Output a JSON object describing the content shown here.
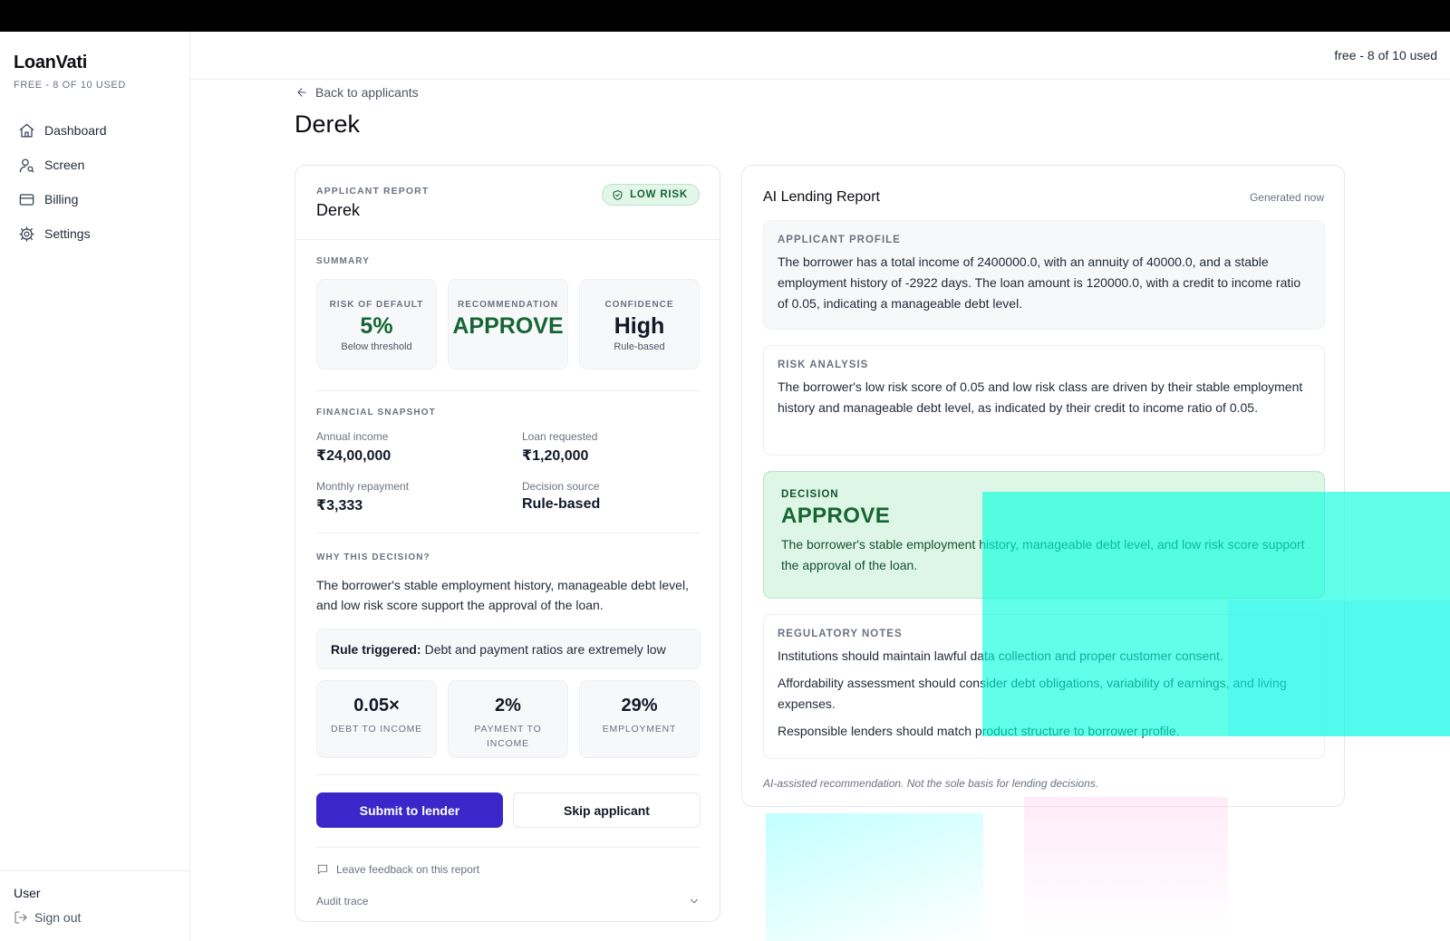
{
  "app": {
    "brand": "LoanVati",
    "plan": "FREE - 8 OF 10 USED",
    "usage": "free - 8 of 10 used"
  },
  "sidebar": {
    "items": [
      {
        "label": "Dashboard",
        "icon": "home-icon"
      },
      {
        "label": "Screen",
        "icon": "user-search-icon"
      },
      {
        "label": "Billing",
        "icon": "credit-card-icon"
      },
      {
        "label": "Settings",
        "icon": "gear-icon"
      }
    ],
    "user_label": "User",
    "signout_label": "Sign out"
  },
  "page": {
    "back_label": "Back to applicants",
    "title": "Derek"
  },
  "applicant_report": {
    "eyebrow": "APPLICANT REPORT",
    "name": "Derek",
    "risk_badge": "LOW RISK",
    "summary_label": "SUMMARY",
    "summary": [
      {
        "label": "RISK OF DEFAULT",
        "value": "5%",
        "sub": "Below threshold"
      },
      {
        "label": "RECOMMENDATION",
        "value": "APPROVE",
        "sub": ""
      },
      {
        "label": "CONFIDENCE",
        "value": "High",
        "sub": "Rule-based"
      }
    ],
    "financial_label": "FINANCIAL SNAPSHOT",
    "financial": [
      {
        "label": "Annual income",
        "value": "₹24,00,000"
      },
      {
        "label": "Loan requested",
        "value": "₹1,20,000"
      },
      {
        "label": "Monthly repayment",
        "value": "₹3,333"
      },
      {
        "label": "Decision source",
        "value": "Rule-based"
      }
    ],
    "why_label": "WHY THIS DECISION?",
    "why_text": "The borrower's stable employment history, manageable debt level, and low risk score support the approval of the loan.",
    "rule_prefix": "Rule triggered:",
    "rule_text": "Debt and payment ratios are extremely low",
    "ratios": [
      {
        "value": "0.05×",
        "label": "DEBT TO INCOME"
      },
      {
        "value": "2%",
        "label": "PAYMENT TO INCOME"
      },
      {
        "value": "29%",
        "label": "EMPLOYMENT"
      }
    ],
    "submit_label": "Submit to lender",
    "skip_label": "Skip applicant",
    "feedback_label": "Leave feedback on this report",
    "audit_label": "Audit trace"
  },
  "ai_report": {
    "title": "AI Lending Report",
    "generated": "Generated now",
    "profile_label": "APPLICANT PROFILE",
    "profile_text": "The borrower has a total income of 2400000.0, with an annuity of 40000.0, and a stable employment history of -2922 days. The loan amount is 120000.0, with a credit to income ratio of 0.05, indicating a manageable debt level.",
    "risk_label": "RISK ANALYSIS",
    "risk_text": "The borrower's low risk score of 0.05 and low risk class are driven by their stable employment history and manageable debt level, as indicated by their credit to income ratio of 0.05.",
    "decision_label": "DECISION",
    "decision_value": "APPROVE",
    "decision_text": "The borrower's stable employment history, manageable debt level, and low risk score support the approval of the loan.",
    "reg_label": "REGULATORY NOTES",
    "reg_notes": [
      "Institutions should maintain lawful data collection and proper customer consent.",
      "Affordability assessment should consider debt obligations, variability of earnings, and living expenses.",
      "Responsible lenders should match product structure to borrower profile."
    ],
    "disclaimer": "AI-assisted recommendation. Not the sole basis for lending decisions."
  },
  "colors": {
    "accent": "#3b27c9",
    "success": "#166534",
    "success_bg": "#ddf6e6",
    "overlay": "#00ffdc"
  }
}
